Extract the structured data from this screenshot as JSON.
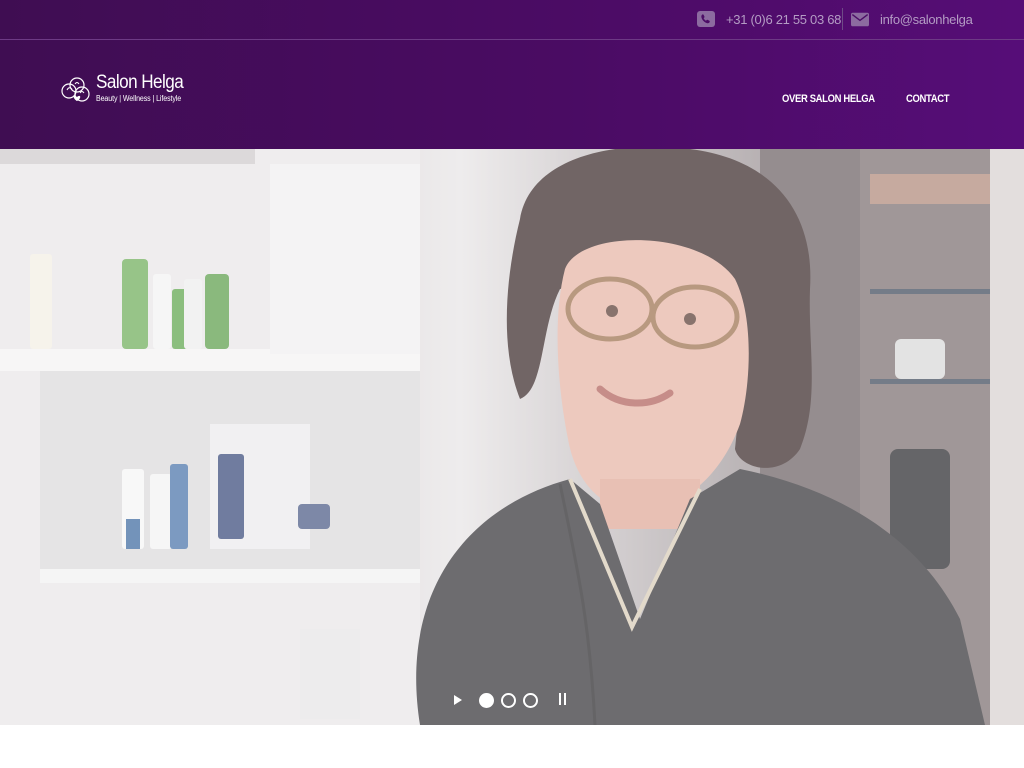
{
  "topbar": {
    "phone": {
      "icon": "phone-square-icon",
      "text": "+31 (0)6 21 55 03 68"
    },
    "email": {
      "icon": "envelope-icon",
      "text": "info@salonhelga"
    }
  },
  "header": {
    "logo": {
      "icon": "salon-helga-logo-icon",
      "name": "Salon Helga",
      "tagline": "Beauty | Wellness | Lifestyle"
    },
    "nav": [
      {
        "label": "OVER SALON HELGA"
      },
      {
        "label": "CONTACT"
      }
    ]
  },
  "hero": {
    "slider": {
      "slides": 3,
      "active_slide": 1,
      "play_icon": "play-icon",
      "pause_icon": "pause-icon"
    }
  },
  "colors": {
    "brand_purple": "#4a0c63",
    "brand_purple_light": "#560d78",
    "topbar_text": "#b49cc4"
  }
}
